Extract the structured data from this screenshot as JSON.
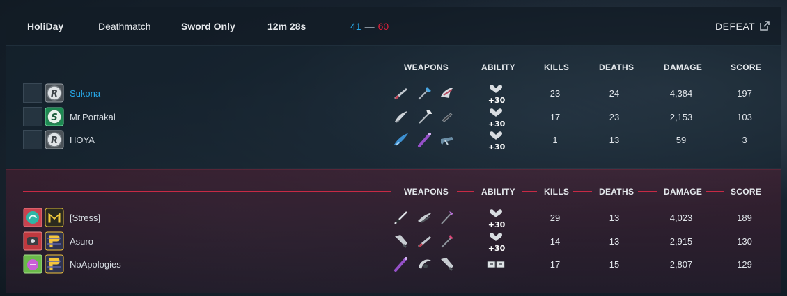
{
  "header": {
    "player": "HoliDay",
    "mode": "Deathmatch",
    "variant": "Sword Only",
    "duration": "12m 28s",
    "score_blue": "41",
    "score_separator": "—",
    "score_red": "60",
    "result": "DEFEAT"
  },
  "columns": {
    "weapons": "WEAPONS",
    "ability": "ABILITY",
    "kills": "KILLS",
    "deaths": "DEATHS",
    "damage": "DAMAGE",
    "score": "SCORE"
  },
  "ability_labels": {
    "health": "+30"
  },
  "colors": {
    "blue_accent": "#27a7e7",
    "red_accent": "#e0203a",
    "mode_red": "#d8262f"
  },
  "teams": [
    {
      "id": "blue",
      "players": [
        {
          "name": "Sukona",
          "rank_icon": "rank-r-icon",
          "ability": "health",
          "kills": "23",
          "deaths": "24",
          "damage": "4,384",
          "score": "197"
        },
        {
          "name": "Mr.Portakal",
          "rank_icon": "rank-s-icon",
          "ability": "health",
          "kills": "17",
          "deaths": "23",
          "damage": "2,153",
          "score": "103"
        },
        {
          "name": "HOYA",
          "rank_icon": "rank-r-icon",
          "ability": "health",
          "kills": "1",
          "deaths": "13",
          "damage": "59",
          "score": "3"
        }
      ]
    },
    {
      "id": "red",
      "players": [
        {
          "name": "[Stress]",
          "rank_icon": "rank-m-icon",
          "ability": "health",
          "kills": "29",
          "deaths": "13",
          "damage": "4,023",
          "score": "189"
        },
        {
          "name": "Asuro",
          "rank_icon": "rank-p-icon",
          "ability": "health",
          "kills": "14",
          "deaths": "13",
          "damage": "2,915",
          "score": "130"
        },
        {
          "name": "NoApologies",
          "rank_icon": "rank-p-icon",
          "ability": "ammo",
          "kills": "17",
          "deaths": "15",
          "damage": "2,807",
          "score": "129"
        }
      ]
    }
  ]
}
